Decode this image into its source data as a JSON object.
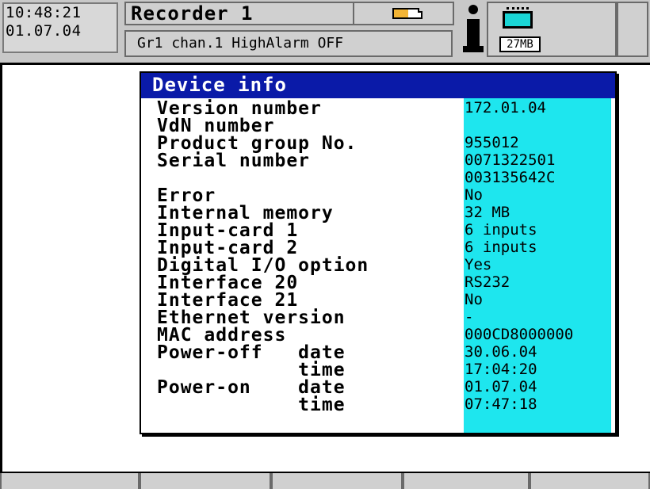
{
  "status": {
    "time": "10:48:21",
    "date": "01.07.04",
    "recorder_title": "Recorder 1",
    "alarm_message": "Gr1 chan.1 HighAlarm OFF",
    "memory_label": "27MB",
    "battery_color": "#f4b535",
    "memory_chip_color": "#1ad6d6"
  },
  "dialog": {
    "title": "Device info",
    "header_color": "#0a1aa8",
    "value_column_color": "#1ee6ee",
    "rows": [
      {
        "label": "Version number",
        "value": "172.01.04"
      },
      {
        "label": "VdN number",
        "value": ""
      },
      {
        "label": "Product group No.",
        "value": "955012"
      },
      {
        "label": "Serial number",
        "value": "0071322501"
      },
      {
        "label": "",
        "value": "003135642C"
      },
      {
        "label": "Error",
        "value": "No"
      },
      {
        "label": "Internal memory",
        "value": "32 MB"
      },
      {
        "label": "Input-card 1",
        "value": "6 inputs"
      },
      {
        "label": "Input-card 2",
        "value": "6 inputs"
      },
      {
        "label": "Digital I/O option",
        "value": "Yes"
      },
      {
        "label": "Interface 20",
        "value": "RS232"
      },
      {
        "label": "Interface 21",
        "value": "No"
      },
      {
        "label": "Ethernet version",
        "value": "-"
      },
      {
        "label": "MAC address",
        "value": "000CD8000000"
      },
      {
        "label": "Power-off   date",
        "value": "30.06.04"
      },
      {
        "label": "            time",
        "value": "17:04:20"
      },
      {
        "label": "Power-on    date",
        "value": "01.07.04"
      },
      {
        "label": "            time",
        "value": "07:47:18"
      }
    ]
  },
  "softkeys": [
    "",
    "",
    "",
    "",
    ""
  ],
  "icons": {
    "battery": "battery-icon",
    "info": "info-icon",
    "memory": "memory-card-icon"
  }
}
